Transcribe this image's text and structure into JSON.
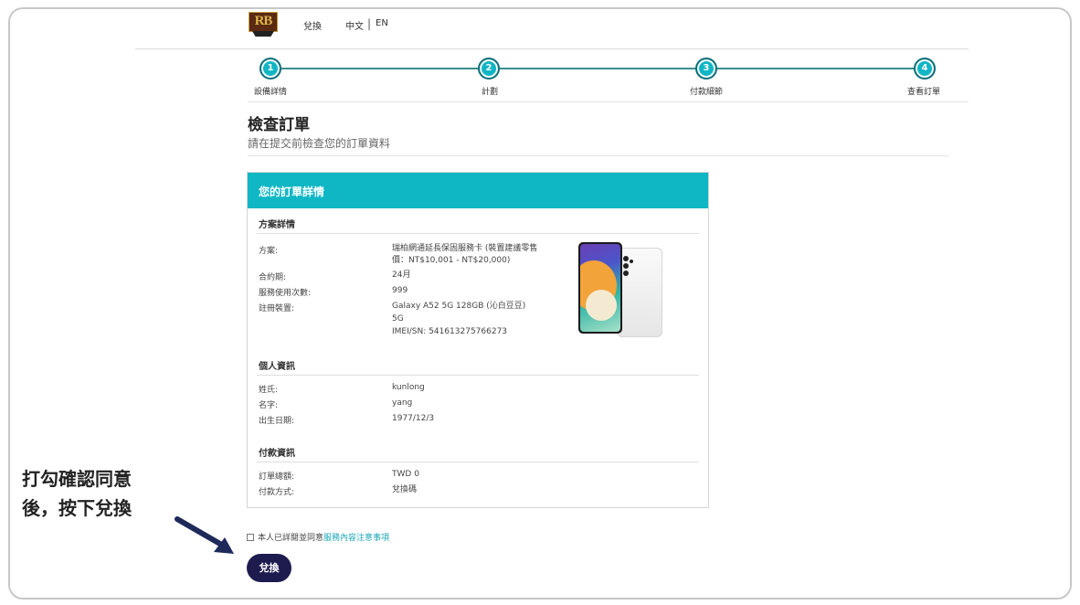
{
  "header": {
    "logo_text": "RB",
    "nav_redeem": "兌換",
    "lang_zh": "中文",
    "lang_sep": "|",
    "lang_en": "EN"
  },
  "steps": [
    {
      "number": "1",
      "label": "設備詳情"
    },
    {
      "number": "2",
      "label": "計劃"
    },
    {
      "number": "3",
      "label": "付款細節"
    },
    {
      "number": "4",
      "label": "查看訂單"
    }
  ],
  "page": {
    "title": "檢查訂單",
    "subtitle": "請在提交前檢查您的訂單資料"
  },
  "order": {
    "header": "您的訂單詳情",
    "plan_section": {
      "title": "方案詳情",
      "plan_label": "方案:",
      "plan_value_line1": "瑞柏網通延長保固服務卡 (裝置建議零售",
      "plan_value_line2": "價：NT$10,001 - NT$20,000)",
      "term_label": "合約期:",
      "term_value": "24月",
      "usage_label": "服務使用次數:",
      "usage_value": "999",
      "device_label": "註冊裝置:",
      "device_value_line1": "Galaxy A52 5G 128GB (沁白豆豆)",
      "device_value_line2": "5G",
      "device_value_line3": "IMEI/SN: 541613275766273"
    },
    "personal_section": {
      "title": "個人資訊",
      "last_name_label": "姓氏:",
      "last_name_value": "kunlong",
      "first_name_label": "名字:",
      "first_name_value": "yang",
      "dob_label": "出生日期:",
      "dob_value": "1977/12/3"
    },
    "payment_section": {
      "title": "付款資訊",
      "total_label": "訂單總額:",
      "total_value": "TWD 0",
      "method_label": "付款方式:",
      "method_value": "兌換碼"
    }
  },
  "consent": {
    "text": "本人已詳閱並同意",
    "link": "服務內容注意事項"
  },
  "submit_label": "兌換",
  "annotation": {
    "line1": "打勾確認同意",
    "line2": "後，按下兌換"
  },
  "colors": {
    "accent": "#0fb7c4",
    "step_line": "#3a8f8f",
    "button": "#1e1b4f",
    "link": "#1aa6b8"
  }
}
